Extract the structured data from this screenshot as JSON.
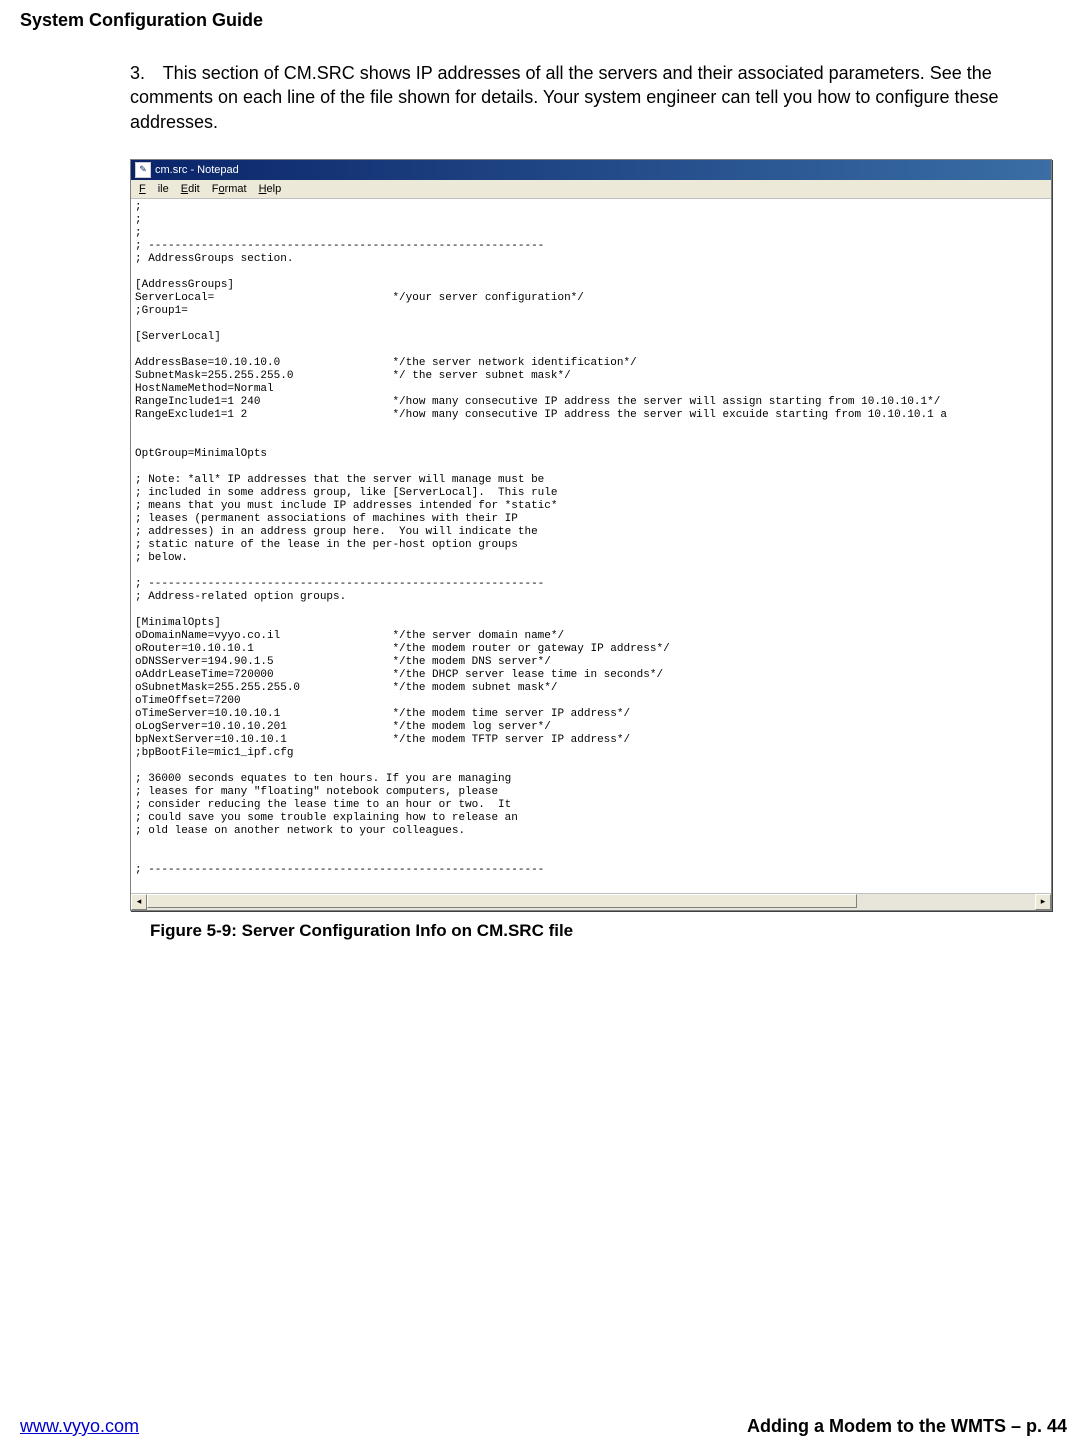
{
  "header": {
    "title": "System Configuration Guide"
  },
  "paragraph": {
    "number": "3.",
    "text": "This section of CM.SRC shows IP addresses of all the servers and their associated parameters.  See the comments on each line of the file shown for details.  Your system engineer can tell you how to configure these addresses."
  },
  "notepad": {
    "title": "cm.src - Notepad",
    "menu": {
      "file": "File",
      "edit": "Edit",
      "format": "Format",
      "help": "Help"
    },
    "content": ";\n;\n;\n; ------------------------------------------------------------\n; AddressGroups section.\n\n[AddressGroups]\nServerLocal=                           */your server configuration*/\n;Group1=\n\n[ServerLocal]\n\nAddressBase=10.10.10.0                 */the server network identification*/\nSubnetMask=255.255.255.0               */ the server subnet mask*/\nHostNameMethod=Normal\nRangeInclude1=1 240                    */how many consecutive IP address the server will assign starting from 10.10.10.1*/\nRangeExclude1=1 2                      */how many consecutive IP address the server will excuide starting from 10.10.10.1 a\n\n\nOptGroup=MinimalOpts\n\n; Note: *all* IP addresses that the server will manage must be\n; included in some address group, like [ServerLocal].  This rule\n; means that you must include IP addresses intended for *static*\n; leases (permanent associations of machines with their IP\n; addresses) in an address group here.  You will indicate the\n; static nature of the lease in the per-host option groups\n; below.\n\n; ------------------------------------------------------------\n; Address-related option groups.\n\n[MinimalOpts]\noDomainName=vyyo.co.il                 */the server domain name*/\noRouter=10.10.10.1                     */the modem router or gateway IP address*/\noDNSServer=194.90.1.5                  */the modem DNS server*/\noAddrLeaseTime=720000                  */the DHCP server lease time in seconds*/\noSubnetMask=255.255.255.0              */the modem subnet mask*/\noTimeOffset=7200\noTimeServer=10.10.10.1                 */the modem time server IP address*/\noLogServer=10.10.10.201                */the modem log server*/\nbpNextServer=10.10.10.1                */the modem TFTP server IP address*/\n;bpBootFile=mic1_ipf.cfg\n\n; 36000 seconds equates to ten hours. If you are managing\n; leases for many \"floating\" notebook computers, please\n; consider reducing the lease time to an hour or two.  It\n; could save you some trouble explaining how to release an\n; old lease on another network to your colleagues.\n\n\n; ------------------------------------------------------------"
  },
  "figure_caption": "Figure 5-9: Server Configuration Info on CM.SRC file",
  "footer": {
    "url": "www.vyyo.com",
    "right": "Adding a Modem to the WMTS – p. 44"
  }
}
